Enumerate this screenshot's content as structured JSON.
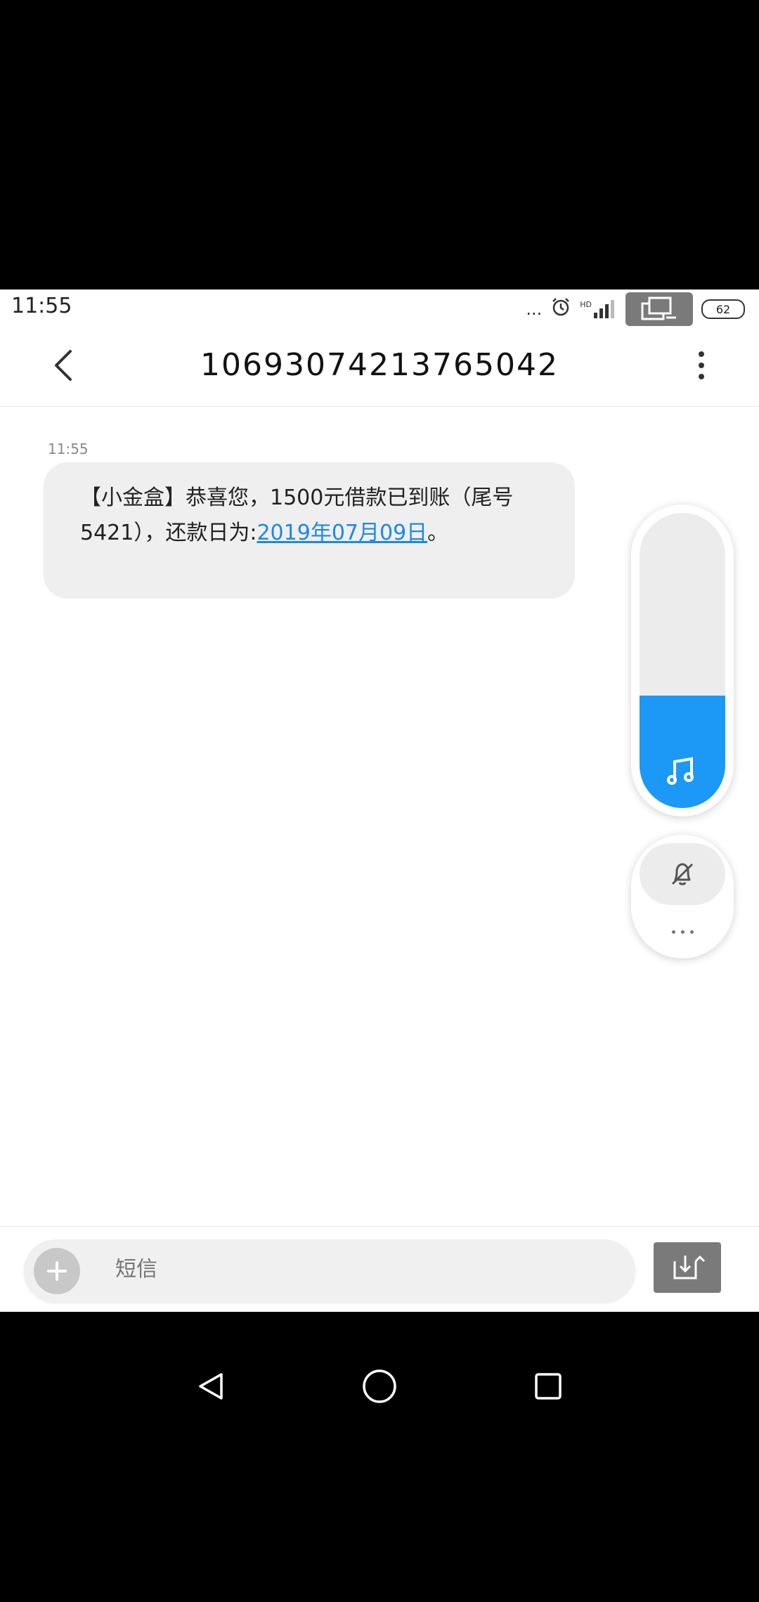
{
  "status_bar": {
    "time": "11:55",
    "dots": "...",
    "network": "HD",
    "battery": "62"
  },
  "header": {
    "title": "10693074213765042"
  },
  "conversation": {
    "messages": [
      {
        "time": "11:55",
        "text_before_link": "【小金盒】恭喜您，1500元借款已到账（尾号5421），还款日为:",
        "link_text": "2019年07月09日",
        "text_after_link": "。"
      }
    ]
  },
  "volume": {
    "level": 0.38,
    "accent_color": "#1c98f7",
    "icon": "music-note-icon",
    "ring_icon": "bell-off-icon"
  },
  "composer": {
    "placeholder": "短信"
  },
  "icons": {
    "back": "chevron-left-icon",
    "more": "more-vertical-icon",
    "add": "plus-icon",
    "send": "share-icon",
    "nav_back": "triangle-back-icon",
    "nav_home": "circle-home-icon",
    "nav_recents": "square-recents-icon"
  }
}
